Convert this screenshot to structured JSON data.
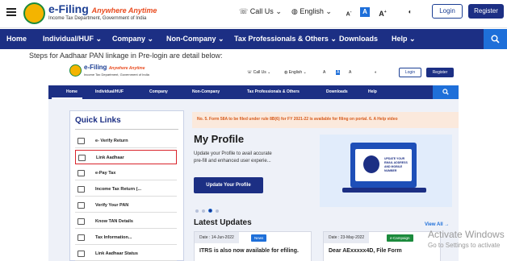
{
  "header": {
    "logo_title": "e-Filing",
    "logo_tagline": "Anywhere Anytime",
    "logo_subtitle": "Income Tax Department, Government of India",
    "call_us": "Call Us",
    "language": "English",
    "font_small": "A",
    "font_default": "A",
    "font_large": "A",
    "login": "Login",
    "register": "Register"
  },
  "nav": {
    "items": [
      "Home",
      "Individual/HUF",
      "Company",
      "Non-Company",
      "Tax Professionals & Others",
      "Downloads",
      "Help"
    ]
  },
  "steps_text": "Steps for Aadhaar PAN linkage in Pre-login are detail below:",
  "screenshot": {
    "header": {
      "logo_title": "e-Filing",
      "logo_tagline": "Anywhere Anytime",
      "logo_subtitle": "Income Tax Department, Government of India",
      "call_us": "Call Us",
      "language": "English",
      "login": "Login",
      "register": "Register"
    },
    "nav": {
      "items": [
        "Home",
        "Individual/HUF",
        "Company",
        "Non-Company",
        "Tax Professionals & Others",
        "Downloads",
        "Help"
      ]
    },
    "quick_links": {
      "title": "Quick Links",
      "items": [
        "e- Verify Return",
        "Link Aadhaar",
        "e-Pay Tax",
        "Income Tax Return (...",
        "Verify Your PAN",
        "Know TAN Details",
        "Tax Information...",
        "Link Aadhaar Status"
      ]
    },
    "ticker": "No. 5. Form 58A to be filed under rule 8B(6) for FY 2021-22 is available for filing on portal. 6. A Help video",
    "profile": {
      "title": "My Profile",
      "desc_line1": "Update your Profile to avail accurate",
      "desc_line2": "pre-fill and enhanced user experie...",
      "button": "Update Your Profile"
    },
    "illustration": {
      "screen_text": "UPDATE YOUR EMAIL ADDRESS AND MOBILE NUMBER"
    },
    "updates": {
      "title": "Latest Updates",
      "view_all": "View All",
      "cards": [
        {
          "date": "Date : 14-Jun-2022",
          "badge": "News",
          "text": "ITRS is also now available for efiling."
        },
        {
          "date": "Date : 23-May-2022",
          "badge": "e-Campaign",
          "text": "Dear AExxxxx4D, File Form"
        }
      ]
    }
  },
  "watermark": {
    "title": "Activate Windows",
    "subtitle": "Go to Settings to activate"
  },
  "colors": {
    "nav_bg": "#1c2f84",
    "search_bg": "#1e6fd9",
    "ticker_text": "#d75a1a",
    "highlight": "#d9242b"
  }
}
